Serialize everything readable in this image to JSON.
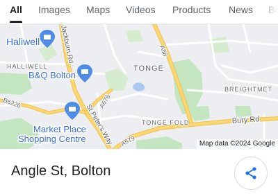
{
  "tabs": [
    {
      "label": "All",
      "active": true
    },
    {
      "label": "Images"
    },
    {
      "label": "Maps"
    },
    {
      "label": "Videos"
    },
    {
      "label": "Products"
    },
    {
      "label": "News"
    },
    {
      "label": "Bo"
    }
  ],
  "map": {
    "labels": {
      "haliwell": "Haliwell",
      "halliwell": "HALLIWELL",
      "bq": "B&Q Bolton",
      "tonge": "TONGE",
      "breightmet": "BREIGHTMET",
      "tonge_fold": "TONGE FOLD",
      "bury_rd": "Bury Rd",
      "market1": "Market Place",
      "market2": "Shopping Centre",
      "jackburn": "Jackburn Rd",
      "stpeters": "St Peter's Way",
      "a58": "A58",
      "a676": "A676",
      "a579": "A579",
      "b6226": "B6226"
    },
    "attribution": "Map data ©2024 Google",
    "colors": {
      "water": "#a9c9f2",
      "park": "#c3e6c1",
      "road_major": "#fbd675",
      "pin": "#4f8ce8"
    }
  },
  "place": {
    "title": "Angle St, Bolton"
  },
  "icons": {
    "share": "share-icon",
    "shopping": "shopping-bag-icon"
  }
}
